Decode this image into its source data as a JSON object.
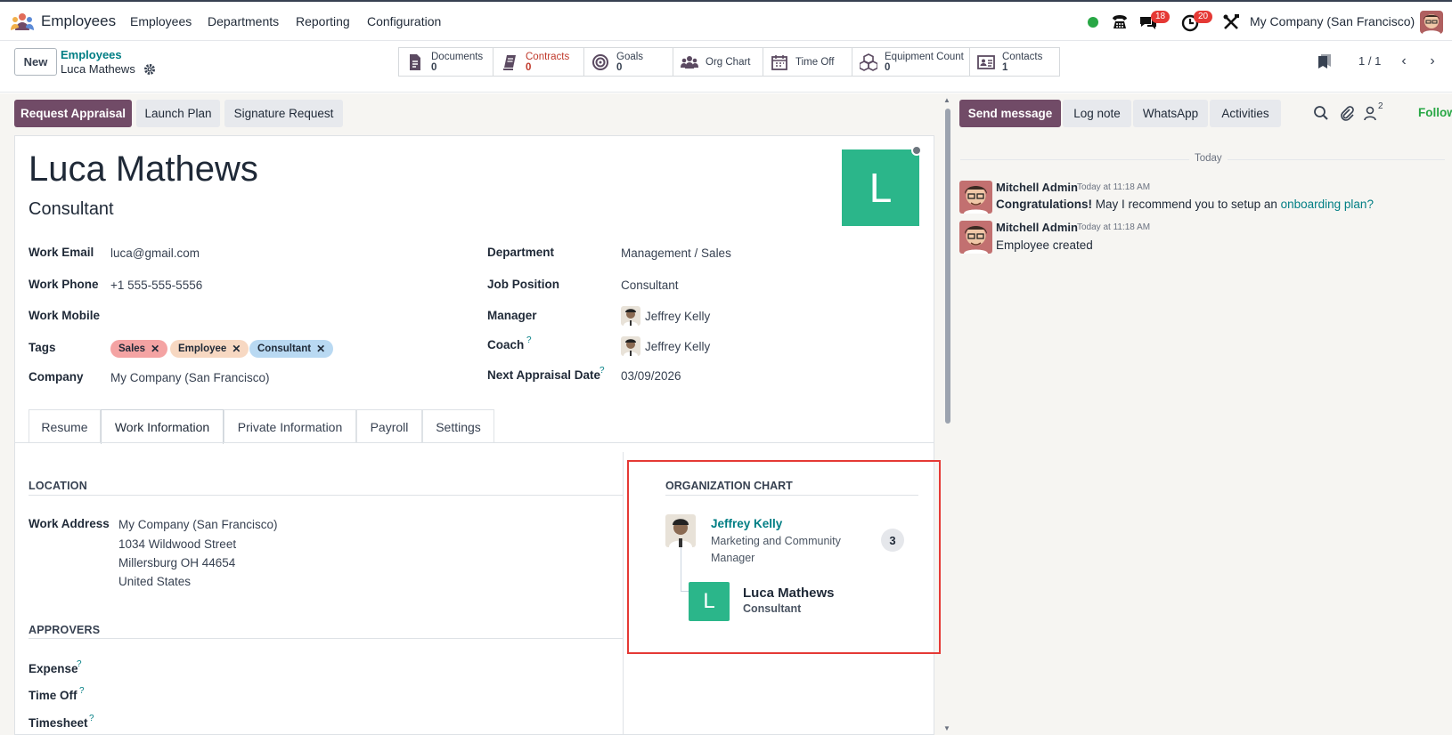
{
  "topbar": {
    "app_name": "Employees",
    "menu": [
      "Employees",
      "Departments",
      "Reporting",
      "Configuration"
    ],
    "messages_badge": "18",
    "activities_badge": "20",
    "company": "My Company (San Francisco)"
  },
  "control": {
    "new_label": "New",
    "breadcrumb_parent": "Employees",
    "breadcrumb_current": "Luca Mathews",
    "pager": "1 / 1",
    "smart_buttons": [
      {
        "label": "Documents",
        "count": "0",
        "icon": "document-icon"
      },
      {
        "label": "Contracts",
        "count": "0",
        "icon": "contract-book-icon"
      },
      {
        "label": "Goals",
        "count": "0",
        "icon": "target-icon"
      },
      {
        "label": "Org Chart",
        "count": "",
        "icon": "people-group-icon"
      },
      {
        "label": "Time Off",
        "count": "",
        "icon": "calendar-icon"
      },
      {
        "label": "Equipment Count",
        "count": "0",
        "icon": "cubes-icon"
      },
      {
        "label": "Contacts",
        "count": "1",
        "icon": "contact-card-icon"
      }
    ]
  },
  "actions": {
    "request_appraisal": "Request Appraisal",
    "launch_plan": "Launch Plan",
    "signature_request": "Signature Request"
  },
  "employee": {
    "name": "Luca Mathews",
    "job_title": "Consultant",
    "avatar_letter": "L"
  },
  "fields": {
    "work_email_label": "Work Email",
    "work_email": "luca@gmail.com",
    "work_phone_label": "Work Phone",
    "work_phone": "+1 555-555-5556",
    "work_mobile_label": "Work Mobile",
    "tags_label": "Tags",
    "tags": [
      "Sales",
      "Employee",
      "Consultant"
    ],
    "company_label": "Company",
    "company": "My Company (San Francisco)",
    "department_label": "Department",
    "department": "Management / Sales",
    "job_position_label": "Job Position",
    "job_position": "Consultant",
    "manager_label": "Manager",
    "manager": "Jeffrey Kelly",
    "coach_label": "Coach",
    "coach": "Jeffrey Kelly",
    "next_appraisal_label": "Next Appraisal Date",
    "next_appraisal": "03/09/2026",
    "help_mark": "?"
  },
  "tabs": [
    "Resume",
    "Work Information",
    "Private Information",
    "Payroll",
    "Settings"
  ],
  "work_info": {
    "location_title": "LOCATION",
    "work_address_label": "Work Address",
    "address_lines": [
      "My Company (San Francisco)",
      "1034 Wildwood Street",
      "Millersburg OH 44654",
      "United States"
    ],
    "approvers_title": "APPROVERS",
    "expense_label": "Expense",
    "time_off_label": "Time Off",
    "timesheet_label": "Timesheet"
  },
  "org_chart": {
    "title": "ORGANIZATION CHART",
    "manager_name": "Jeffrey Kelly",
    "manager_job": "Marketing and Community Manager",
    "manager_count": "3",
    "self_letter": "L",
    "self_name": "Luca Mathews",
    "self_job": "Consultant"
  },
  "chatter": {
    "send_message": "Send message",
    "log_note": "Log note",
    "whatsapp": "WhatsApp",
    "activities": "Activities",
    "followers_count": "2",
    "following": "Following",
    "today": "Today",
    "messages": [
      {
        "author": "Mitchell Admin",
        "time": "Today at 11:18 AM",
        "bold": "Congratulations!",
        "text": " May I recommend you to setup an ",
        "link": "onboarding plan?"
      },
      {
        "author": "Mitchell Admin",
        "time": "Today at 11:18 AM",
        "text": "Employee created"
      }
    ]
  },
  "colors": {
    "primary": "#714b67",
    "avatar_green": "#2bb68a",
    "link_teal": "#017e84",
    "highlight_red": "#e53935",
    "following_green": "#28a745"
  }
}
